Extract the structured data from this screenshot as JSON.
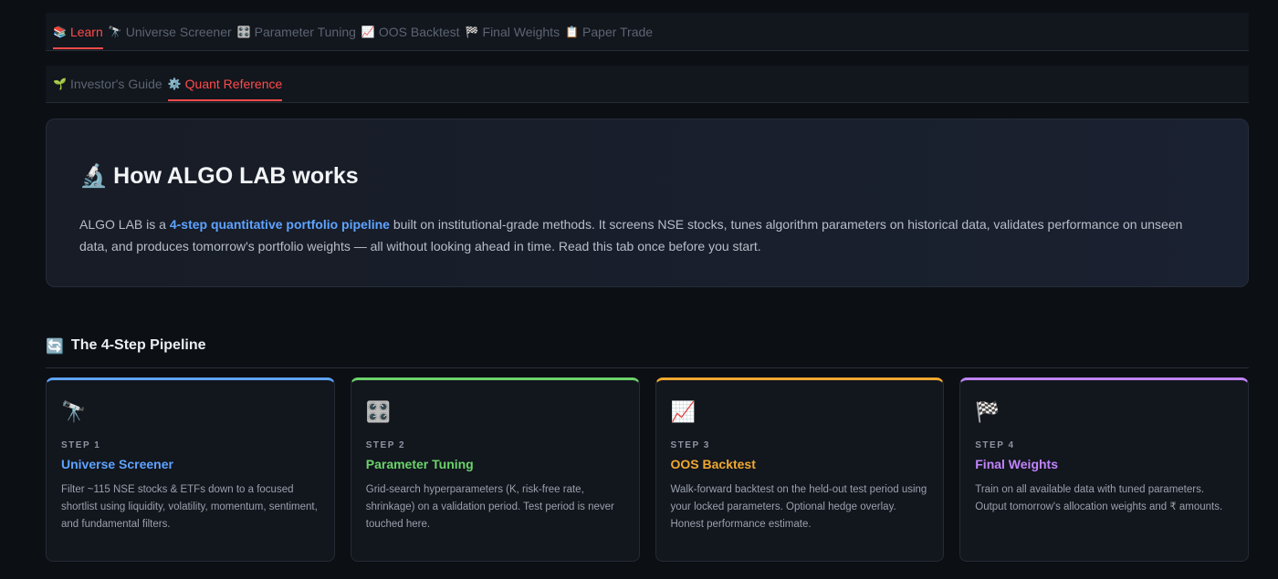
{
  "top_tabs": [
    {
      "icon": "📚",
      "label": "Learn",
      "active": true
    },
    {
      "icon": "🔭",
      "label": "Universe Screener"
    },
    {
      "icon": "🎛️",
      "label": "Parameter Tuning"
    },
    {
      "icon": "📈",
      "label": "OOS Backtest"
    },
    {
      "icon": "🏁",
      "label": "Final Weights"
    },
    {
      "icon": "📋",
      "label": "Paper Trade"
    }
  ],
  "sub_tabs": [
    {
      "icon": "🌱",
      "label": "Investor's Guide"
    },
    {
      "icon": "⚙️",
      "label": "Quant Reference",
      "active": true
    }
  ],
  "hero": {
    "icon": "🔬",
    "title": "How ALGO LAB works",
    "text_before": "ALGO LAB is a ",
    "highlight": "4-step quantitative portfolio pipeline",
    "text_after": " built on institutional-grade methods. It screens NSE stocks, tunes algorithm parameters on historical data, validates performance on unseen data, and produces tomorrow's portfolio weights — all without looking ahead in time. Read this tab once before you start."
  },
  "pipeline": {
    "icon": "🔄",
    "title": "The 4-Step Pipeline",
    "steps": [
      {
        "icon": "🔭",
        "step": "STEP 1",
        "title": "Universe Screener",
        "color": "#5ea3ff",
        "desc": "Filter ~115 NSE stocks & ETFs down to a focused shortlist using liquidity, volatility, momentum, sentiment, and fundamental filters."
      },
      {
        "icon": "🎛️",
        "step": "STEP 2",
        "title": "Parameter Tuning",
        "color": "#6bd36b",
        "desc": "Grid-search hyperparameters (K, risk-free rate, shrinkage) on a validation period. Test period is never touched here."
      },
      {
        "icon": "📈",
        "step": "STEP 3",
        "title": "OOS Backtest",
        "color": "#f0a830",
        "desc": "Walk-forward backtest on the held-out test period using your locked parameters. Optional hedge overlay. Honest performance estimate."
      },
      {
        "icon": "🏁",
        "step": "STEP 4",
        "title": "Final Weights",
        "color": "#c084fc",
        "desc": "Train on all available data with tuned parameters. Output tomorrow's allocation weights and ₹ amounts."
      }
    ]
  }
}
